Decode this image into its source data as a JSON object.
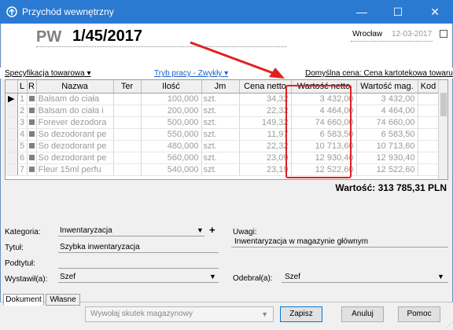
{
  "window": {
    "title": "Przychód wewnętrzny",
    "minimize_glyph": "—",
    "maximize_glyph": "☐",
    "close_glyph": "✕"
  },
  "header": {
    "doc_prefix": "PW",
    "doc_number": "1/45/2017",
    "city": "Wrocław",
    "date": "12-03-2017"
  },
  "links": {
    "spec": "Specyfikacja towarowa",
    "tryb": "Tryb pracy - Zwykły",
    "domyslna_cena": "Domyślna cena: Cena kartotekowa towaru"
  },
  "grid": {
    "columns": [
      "L",
      "R",
      "Nazwa",
      "Ter",
      "Ilość",
      "Jm",
      "Cena netto",
      "Wartość netto",
      "Wartość mag.",
      "Kod"
    ],
    "current_row_marker": "▶",
    "rows": [
      {
        "lp": "1",
        "nazwa": "Balsam do ciała",
        "ter": "",
        "ilosc": "100,000",
        "jm": "szt.",
        "cena": "34,32",
        "wartosc": "3 432,00",
        "wartosc_mag": "3 432,00",
        "kod": ""
      },
      {
        "lp": "2",
        "nazwa": "Balsam do ciała i",
        "ter": "",
        "ilosc": "200,000",
        "jm": "szt.",
        "cena": "22,32",
        "wartosc": "4 464,00",
        "wartosc_mag": "4 464,00",
        "kod": ""
      },
      {
        "lp": "3",
        "nazwa": "Forever dezodora",
        "ter": "",
        "ilosc": "500,000",
        "jm": "szt.",
        "cena": "149,32",
        "wartosc": "74 660,00",
        "wartosc_mag": "74 660,00",
        "kod": ""
      },
      {
        "lp": "4",
        "nazwa": "So dezodorant pe",
        "ter": "",
        "ilosc": "550,000",
        "jm": "szt.",
        "cena": "11,97",
        "wartosc": "6 583,50",
        "wartosc_mag": "6 583,50",
        "kod": ""
      },
      {
        "lp": "5",
        "nazwa": "So dezodorant pe",
        "ter": "",
        "ilosc": "480,000",
        "jm": "szt.",
        "cena": "22,32",
        "wartosc": "10 713,60",
        "wartosc_mag": "10 713,60",
        "kod": ""
      },
      {
        "lp": "6",
        "nazwa": "So dezodorant pe",
        "ter": "",
        "ilosc": "560,000",
        "jm": "szt.",
        "cena": "23,09",
        "wartosc": "12 930,40",
        "wartosc_mag": "12 930,40",
        "kod": ""
      },
      {
        "lp": "7",
        "nazwa": "Fleur 15ml perfu",
        "ter": "",
        "ilosc": "540,000",
        "jm": "szt.",
        "cena": "23,19",
        "wartosc": "12 522,60",
        "wartosc_mag": "12 522,60",
        "kod": ""
      }
    ]
  },
  "total": "Wartość: 313 785,31 PLN",
  "form": {
    "kategoria_label": "Kategoria:",
    "kategoria_value": "Inwentaryzacja",
    "tytul_label": "Tytuł:",
    "tytul_value": "Szybka inwentaryzacja",
    "podtytul_label": "Podtytuł:",
    "podtytul_value": "",
    "wystawil_label": "Wystawił(a):",
    "wystawil_value": "Szef",
    "uwagi_label": "Uwagi:",
    "uwagi_value": "Inwentaryzacja w magazynie głównym",
    "odebral_label": "Odebrał(a):",
    "odebral_value": "Szef"
  },
  "tabs": [
    "Dokument",
    "Własne"
  ],
  "bottom": {
    "skutek": "Wywołaj skutek magazynowy",
    "zapisz": "Zapisz",
    "anuluj": "Anuluj",
    "pomoc": "Pomoc"
  },
  "colors": {
    "titlebar": "#2b7ad2",
    "highlight": "#e02020",
    "link": "#1a5fcf"
  }
}
